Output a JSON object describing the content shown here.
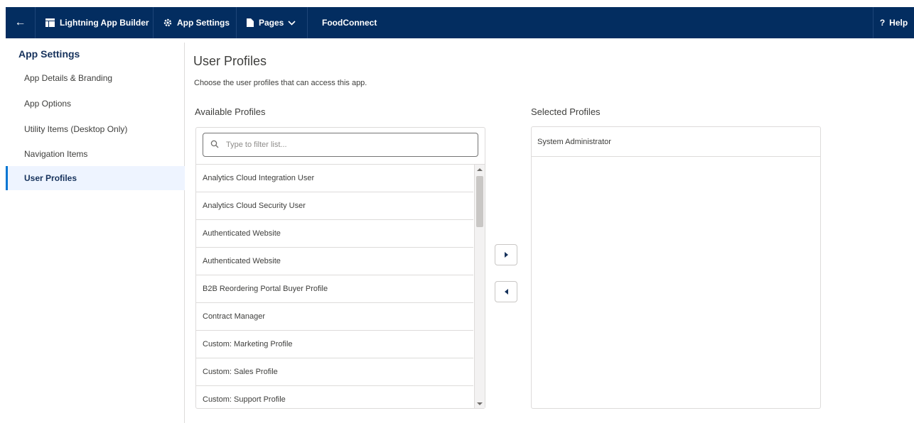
{
  "nav": {
    "back_icon": "back-arrow-icon",
    "builder_label": "Lightning App Builder",
    "settings_label": "App Settings",
    "pages_label": "Pages",
    "app_name": "FoodConnect",
    "help_label": "Help"
  },
  "sidebar": {
    "title": "App Settings",
    "items": [
      {
        "label": "App Details & Branding"
      },
      {
        "label": "App Options"
      },
      {
        "label": "Utility Items (Desktop Only)"
      },
      {
        "label": "Navigation Items"
      },
      {
        "label": "User Profiles"
      }
    ]
  },
  "main": {
    "title": "User Profiles",
    "description": "Choose the user profiles that can access this app.",
    "available_label": "Available Profiles",
    "selected_label": "Selected Profiles",
    "search_placeholder": "Type to filter list...",
    "available_items": [
      "Analytics Cloud Integration User",
      "Analytics Cloud Security User",
      "Authenticated Website",
      "Authenticated Website",
      "B2B Reordering Portal Buyer Profile",
      "Contract Manager",
      "Custom: Marketing Profile",
      "Custom: Sales Profile",
      "Custom: Support Profile"
    ],
    "selected_items": [
      "System Administrator"
    ]
  },
  "colors": {
    "nav_bg": "#032d60",
    "active_bg": "#eef4ff",
    "accent": "#0176d3"
  }
}
